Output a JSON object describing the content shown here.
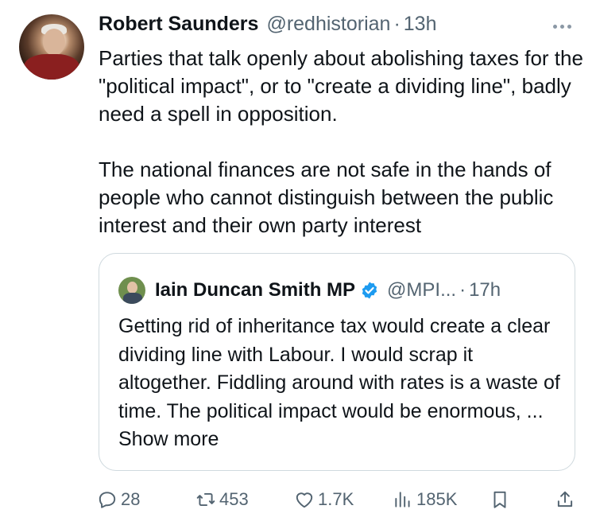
{
  "tweet": {
    "author_name": "Robert Saunders",
    "author_handle": "@redhistorian",
    "separator": "·",
    "time": "13h",
    "paragraphs": [
      "Parties that talk openly about abolishing taxes for the \"political impact\", or to \"create a dividing line\", badly need a spell in opposition.",
      "The national finances are not safe in the hands of people who cannot distinguish between the public interest and their own party interest"
    ]
  },
  "quoted": {
    "author_name": "Iain Duncan Smith MP",
    "author_handle": "@MPI...",
    "separator": "·",
    "time": "17h",
    "text": "Getting rid of inheritance tax would create a clear dividing line with Labour. I would scrap it altogether. Fiddling around with rates is a waste of time. The political impact would be enormous, ... ",
    "show_more": "Show more"
  },
  "actions": {
    "replies": "28",
    "reposts": "453",
    "likes": "1.7K",
    "views": "185K"
  },
  "icons": {
    "reply": "reply-icon",
    "repost": "repost-icon",
    "like": "heart-icon",
    "views": "views-icon",
    "bookmark": "bookmark-icon",
    "share": "share-icon",
    "more": "more-icon",
    "verified": "verified-badge-icon"
  },
  "colors": {
    "text": "#0f1419",
    "muted": "#536471",
    "verified": "#1d9bf0",
    "border": "#cfd9de"
  }
}
